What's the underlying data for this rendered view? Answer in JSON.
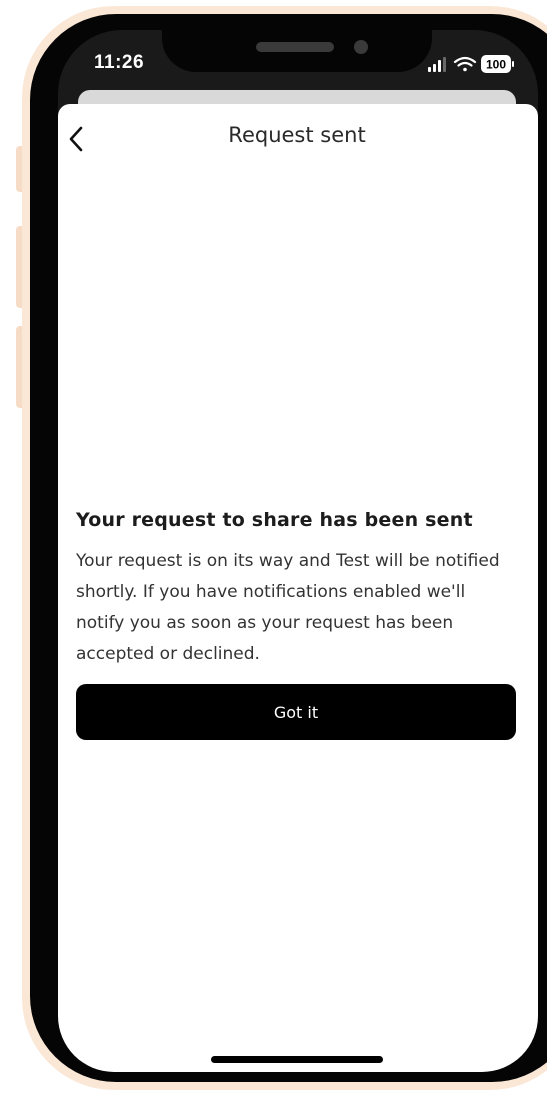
{
  "status_bar": {
    "time": "11:26",
    "battery": "100",
    "icons": [
      "signal-icon",
      "wifi-icon",
      "battery-icon"
    ]
  },
  "nav": {
    "title": "Request sent",
    "back_icon": "chevron-left-icon"
  },
  "content": {
    "heading": "Your request to share has been sent",
    "body": "Your request is on its way and Test will be notified shortly. If you have notifications enabled we'll notify you as soon as your request has been accepted or declined."
  },
  "actions": {
    "primary_label": "Got it"
  },
  "colors": {
    "casing": "#fbe7d6",
    "bezel": "#050505",
    "button": "#000000",
    "button_text": "#ffffff",
    "text": "#333333"
  }
}
